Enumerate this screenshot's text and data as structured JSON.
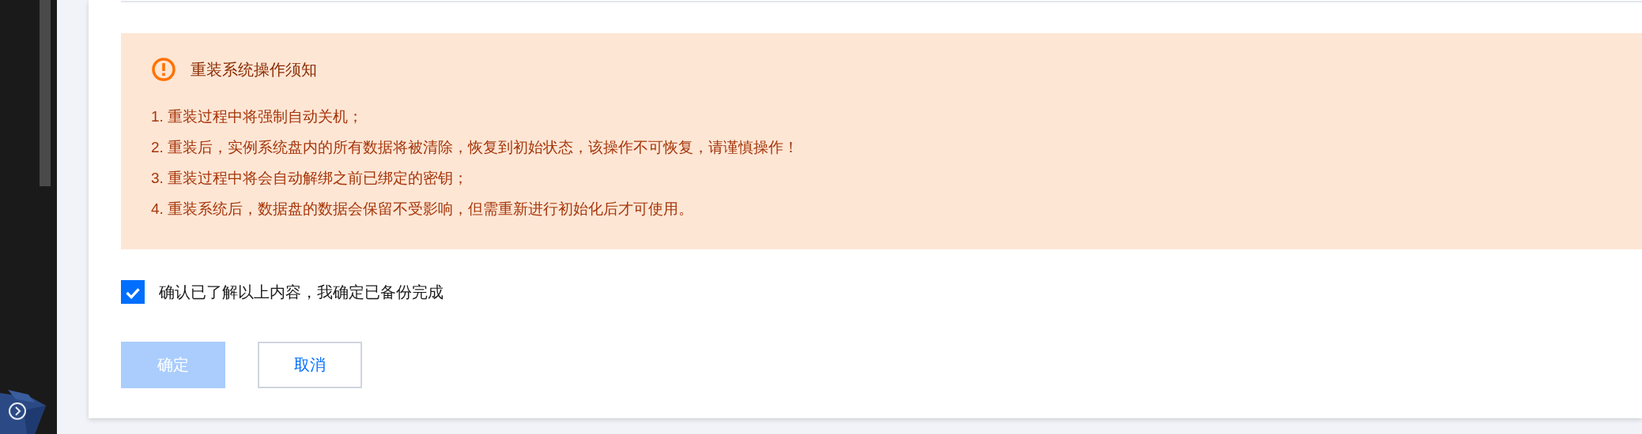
{
  "notice": {
    "title": "重装系统操作须知",
    "items": [
      "1. 重装过程中将强制自动关机；",
      "2. 重装后，实例系统盘内的所有数据将被清除，恢复到初始状态，该操作不可恢复，请谨慎操作！",
      "3. 重装过程中将会自动解绑之前已绑定的密钥；",
      "4. 重装系统后，数据盘的数据会保留不受影响，但需重新进行初始化后才可使用。"
    ]
  },
  "confirm_checkbox": {
    "label": "确认已了解以上内容，我确定已备份完成",
    "checked": true
  },
  "buttons": [
    {
      "label": "确定",
      "kind": "primary",
      "disabled": true
    },
    {
      "label": "取消",
      "kind": "secondary",
      "disabled": false
    }
  ]
}
